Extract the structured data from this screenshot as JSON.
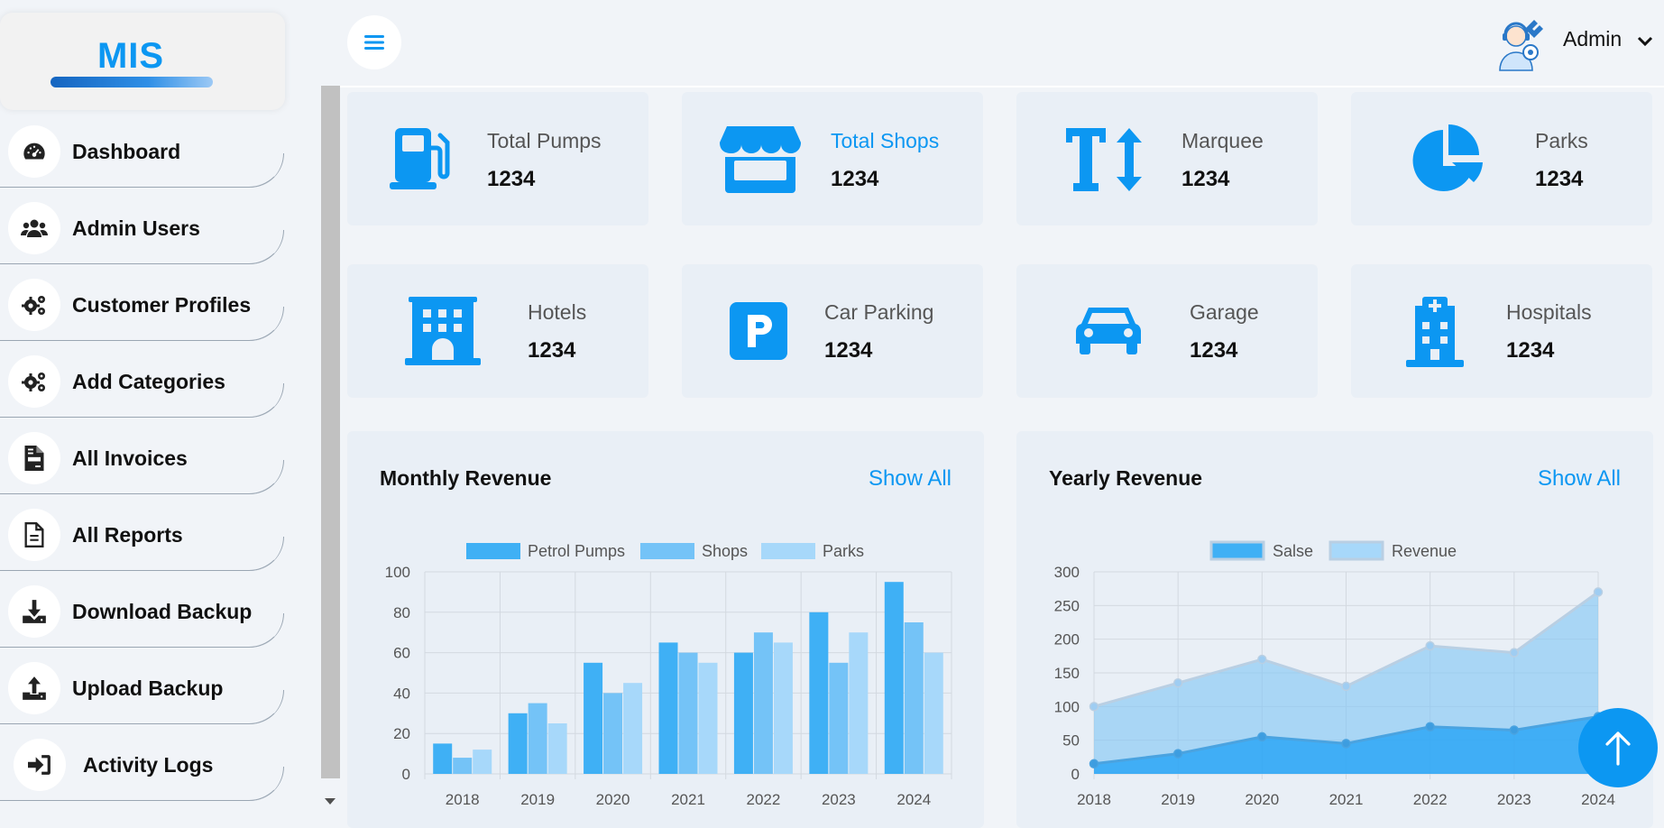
{
  "brand": {
    "name": "MIS"
  },
  "sidebar": {
    "items": [
      {
        "label": "Dashboard",
        "icon": "gauge-icon"
      },
      {
        "label": "Admin Users",
        "icon": "users-icon"
      },
      {
        "label": "Customer Profiles",
        "icon": "gears-icon"
      },
      {
        "label": "Add Categories",
        "icon": "gears-icon"
      },
      {
        "label": "All Invoices",
        "icon": "invoice-icon"
      },
      {
        "label": "All Reports",
        "icon": "report-icon"
      },
      {
        "label": "Download Backup",
        "icon": "download-icon"
      },
      {
        "label": "Upload Backup",
        "icon": "upload-icon"
      },
      {
        "label": "Activity Logs",
        "icon": "sign-in-icon"
      }
    ]
  },
  "topbar": {
    "user_name": "Admin"
  },
  "stats": [
    {
      "label": "Total Pumps",
      "value": "1234",
      "icon": "gas-pump-icon"
    },
    {
      "label": "Total Shops",
      "value": "1234",
      "icon": "shop-icon"
    },
    {
      "label": "Marquee",
      "value": "1234",
      "icon": "text-height-icon"
    },
    {
      "label": "Parks",
      "value": "1234",
      "icon": "pie-chart-icon"
    },
    {
      "label": "Hotels",
      "value": "1234",
      "icon": "hotel-icon"
    },
    {
      "label": "Car Parking",
      "value": "1234",
      "icon": "parking-icon"
    },
    {
      "label": "Garage",
      "value": "1234",
      "icon": "car-icon"
    },
    {
      "label": "Hospitals",
      "value": "1234",
      "icon": "hospital-icon"
    }
  ],
  "colors": {
    "accent": "#0c97f2",
    "card_bg": "#e9eff6",
    "page_bg": "#f1f4f8"
  },
  "monthly_card": {
    "title": "Monthly Revenue",
    "link": "Show All"
  },
  "yearly_card": {
    "title": "Yearly Revenue",
    "link": "Show All"
  },
  "chart_data": [
    {
      "type": "bar",
      "categories": [
        "2018",
        "2019",
        "2020",
        "2021",
        "2022",
        "2023",
        "2024"
      ],
      "series": [
        {
          "name": "Petrol Pumps",
          "values": [
            15,
            30,
            55,
            65,
            60,
            80,
            95
          ],
          "color": "#3fb0f5"
        },
        {
          "name": "Shops",
          "values": [
            8,
            35,
            40,
            60,
            70,
            55,
            75
          ],
          "color": "#74c3f7"
        },
        {
          "name": "Parks",
          "values": [
            12,
            25,
            45,
            55,
            65,
            70,
            60
          ],
          "color": "#a7d8fa"
        }
      ],
      "ylim": [
        0,
        100
      ],
      "yticks": [
        0,
        20,
        40,
        60,
        80,
        100
      ],
      "legend": "top",
      "grid": true
    },
    {
      "type": "area",
      "categories": [
        "2018",
        "2019",
        "2020",
        "2021",
        "2022",
        "2023",
        "2024"
      ],
      "series": [
        {
          "name": "Salse",
          "values": [
            15,
            30,
            55,
            45,
            70,
            65,
            85
          ],
          "color": "#3fb0f5"
        },
        {
          "name": "Revenue",
          "values": [
            100,
            135,
            170,
            130,
            190,
            180,
            270
          ],
          "color": "#a7d8fa"
        }
      ],
      "ylim": [
        0,
        300
      ],
      "yticks": [
        0,
        50,
        100,
        150,
        200,
        250,
        300
      ],
      "legend": "top",
      "grid": true
    }
  ]
}
